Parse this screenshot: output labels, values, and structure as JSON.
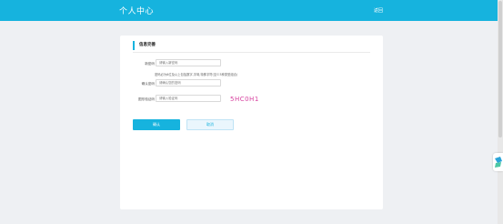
{
  "header": {
    "title": "个人中心",
    "back_label": "返回"
  },
  "section": {
    "title": "信息完善"
  },
  "form": {
    "new_password": {
      "label": "新密码",
      "placeholder": "请输入新密码"
    },
    "hint": "密码必为6位及以上包括数字,字母,特殊字符(至少3种类型组合)",
    "confirm_password": {
      "label": "确认密码",
      "placeholder": "请确认您的密码"
    },
    "captcha": {
      "label": "图形验证码",
      "placeholder": "请输入验证码",
      "code": "5HC0H1"
    }
  },
  "buttons": {
    "ok_label": "确认",
    "cancel_label": "取消"
  },
  "colors": {
    "accent": "#16b3de",
    "captcha": "#d63f9e"
  }
}
